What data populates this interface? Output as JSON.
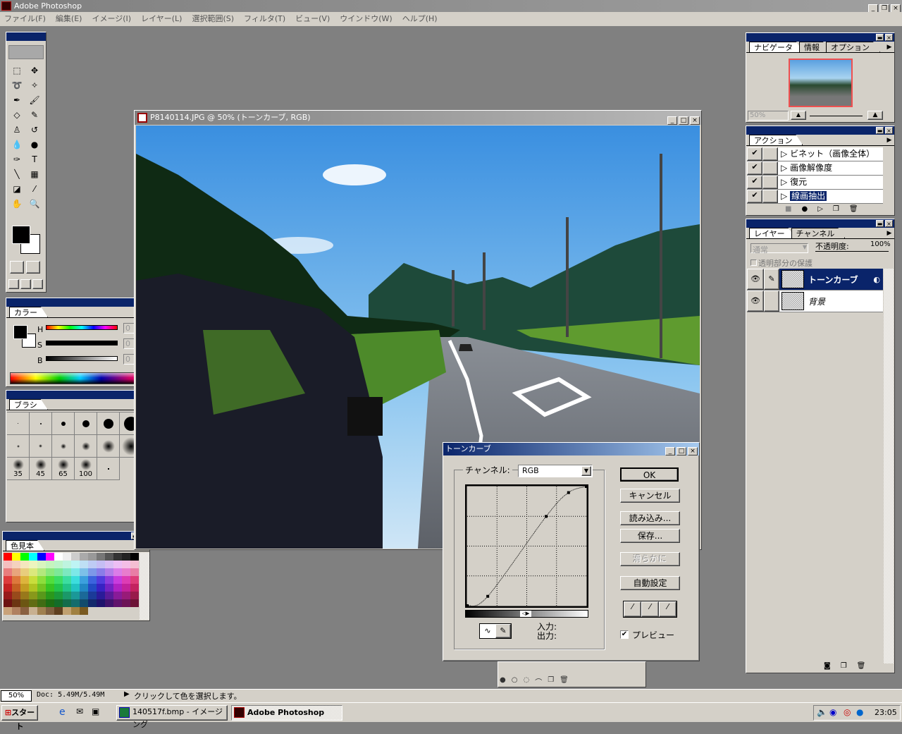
{
  "app": {
    "title": "Adobe Photoshop"
  },
  "menu": [
    "ファイル(F)",
    "編集(E)",
    "イメージ(I)",
    "レイヤー(L)",
    "選択範囲(S)",
    "フィルタ(T)",
    "ビュー(V)",
    "ウインドウ(W)",
    "ヘルプ(H)"
  ],
  "document": {
    "title": "P8140114.JPG @ 50% (トーンカーブ, RGB)"
  },
  "color_panel": {
    "tab": "カラー",
    "labels": [
      "H",
      "S",
      "B"
    ],
    "values": [
      "0",
      "0",
      "0"
    ],
    "units": [
      "°",
      "%",
      "%"
    ]
  },
  "brush_panel": {
    "tab": "ブラシ",
    "sizes": [
      "35",
      "45",
      "65",
      "100"
    ]
  },
  "swatch_panel": {
    "tab": "色見本"
  },
  "navigator": {
    "tabs": [
      "ナビゲータ",
      "情報",
      "オプション"
    ],
    "zoom": "50%"
  },
  "actions": {
    "tab": "アクション",
    "items": [
      {
        "label": "ビネット（画像全体）",
        "checked": true
      },
      {
        "label": "画像解像度",
        "checked": true
      },
      {
        "label": "復元",
        "checked": true
      },
      {
        "label": "線画抽出",
        "checked": true,
        "selected": true
      }
    ]
  },
  "layers": {
    "tabs": [
      "レイヤー",
      "チャンネル"
    ],
    "blend_mode": "通常",
    "opacity_label": "不透明度:",
    "opacity": "100%",
    "preserve_transparency": "透明部分の保護",
    "items": [
      {
        "name": "トーンカーブ",
        "selected": true
      },
      {
        "name": "背景",
        "selected": false
      }
    ]
  },
  "curves": {
    "title": "トーンカーブ",
    "channel_label": "チャンネル:",
    "channel": "RGB",
    "ok": "OK",
    "cancel": "キャンセル",
    "load": "読み込み...",
    "save": "保存...",
    "smooth": "滑らかに",
    "auto": "自動設定",
    "input_label": "入力:",
    "output_label": "出力:",
    "preview": "プレビュー",
    "preview_checked": true,
    "points": [
      [
        0,
        0
      ],
      [
        44,
        20
      ],
      [
        169,
        191
      ],
      [
        217,
        242
      ],
      [
        255,
        255
      ]
    ]
  },
  "status": {
    "zoom": "50%",
    "doc": "Doc: 5.49M/5.49M",
    "message": "クリックして色を選択します。"
  },
  "taskbar": {
    "start": "スタート",
    "tasks": [
      "140517f.bmp - イメージング",
      "Adobe Photoshop"
    ],
    "time": "23:05"
  }
}
